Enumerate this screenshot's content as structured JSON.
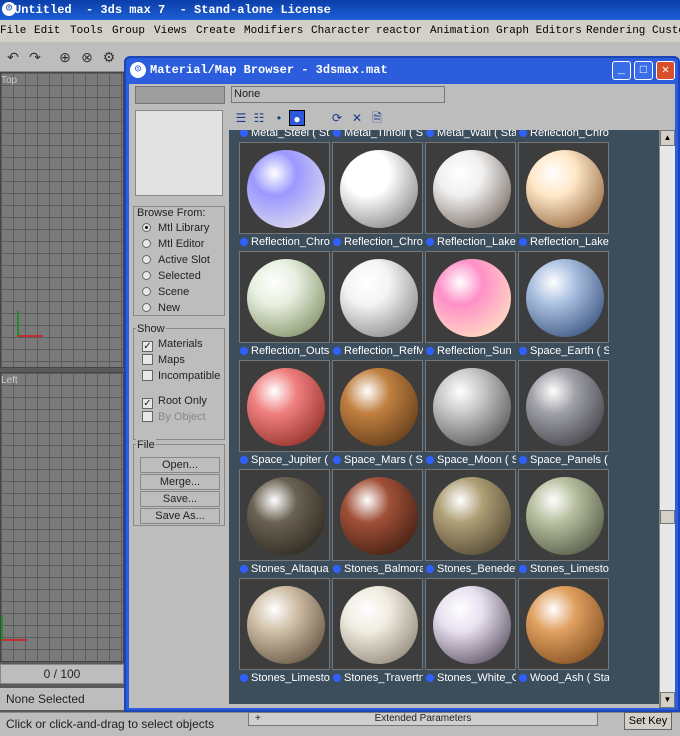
{
  "app": {
    "title": "Untitled  - 3ds max 7  - Stand-alone License",
    "menu": [
      "File",
      "Edit",
      "Tools",
      "Group",
      "Views",
      "Create",
      "Modifiers",
      "Character",
      "reactor",
      "Animation",
      "Graph Editors",
      "Rendering",
      "Custo"
    ]
  },
  "viewports": {
    "top_label": "Top",
    "left_label": "Left"
  },
  "timeslider": {
    "text": "0 / 100"
  },
  "status": {
    "selection": "None Selected",
    "prompt": "Click or click-and-drag to select objects",
    "set_key": "Set Key",
    "extended_params": "Extended Parameters"
  },
  "dialog": {
    "title": "Material/Map Browser - 3dsmax.mat",
    "filter_value": "None",
    "browse_from": {
      "label": "Browse From:",
      "options": [
        "Mtl Library",
        "Mtl Editor",
        "Active Slot",
        "Selected",
        "Scene",
        "New"
      ],
      "selected": "Mtl Library"
    },
    "show": {
      "label": "Show",
      "materials": "Materials",
      "maps": "Maps",
      "incompatible": "Incompatible",
      "root_only": "Root Only",
      "by_object": "By Object"
    },
    "file": {
      "label": "File",
      "buttons": [
        "Open...",
        "Merge...",
        "Save...",
        "Save As..."
      ]
    },
    "materials": [
      {
        "label": "Metal_Steel  ( St",
        "c1": "#d0d0d0",
        "c2": "#555"
      },
      {
        "label": "Metal_Tinfoil  ( S",
        "c1": "#e0e0e0",
        "c2": "#666"
      },
      {
        "label": "Metal_Wall  ( Sta",
        "c1": "#bbb",
        "c2": "#444"
      },
      {
        "label": "Reflection_Chror",
        "c1": "#ccc",
        "c2": "#555"
      },
      {
        "label": "Reflection_Chror",
        "c1": "#9a98ff",
        "c2": "#f0efe8"
      },
      {
        "label": "Reflection_Chror",
        "c1": "#ffffff",
        "c2": "#6a6a6a"
      },
      {
        "label": "Reflection_Lake",
        "c1": "#f0f0f0",
        "c2": "#5a4a40"
      },
      {
        "label": "Reflection_Lake",
        "c1": "#ffe8c8",
        "c2": "#7a4a20"
      },
      {
        "label": "Reflection_Outsi",
        "c1": "#e8f0e0",
        "c2": "#6a7a4a"
      },
      {
        "label": "Reflection_RefM",
        "c1": "#f4f4f4",
        "c2": "#707070"
      },
      {
        "label": "Reflection_Sun",
        "c1": "#ff90c8",
        "c2": "#fff4c0"
      },
      {
        "label": "Space_Earth  ( S",
        "c1": "#aac0e0",
        "c2": "#203a68"
      },
      {
        "label": "Space_Jupiter  (",
        "c1": "#f08080",
        "c2": "#7a1a10"
      },
      {
        "label": "Space_Mars  ( Sp",
        "c1": "#c08040",
        "c2": "#4a2a10"
      },
      {
        "label": "Space_Moon  ( S",
        "c1": "#c8c8c8",
        "c2": "#3a3a3a"
      },
      {
        "label": "Space_Panels  (",
        "c1": "#a0a0a8",
        "c2": "#2a2a30"
      },
      {
        "label": "Stones_Altaqua",
        "c1": "#6a6252",
        "c2": "#1e1a14"
      },
      {
        "label": "Stones_Balmora",
        "c1": "#a05038",
        "c2": "#2a1208"
      },
      {
        "label": "Stones_Benedet",
        "c1": "#b0a078",
        "c2": "#3a3020"
      },
      {
        "label": "Stones_Limestor",
        "c1": "#b8c0a0",
        "c2": "#3a4030"
      },
      {
        "label": "Stones_Limestor",
        "c1": "#d0c0a8",
        "c2": "#4a3a28"
      },
      {
        "label": "Stones_Travertn",
        "c1": "#f0ece0",
        "c2": "#7a7060"
      },
      {
        "label": "Stones_White_G",
        "c1": "#e8e0f0",
        "c2": "#3a3040"
      },
      {
        "label": "Wood_Ash  ( Sta",
        "c1": "#e0a060",
        "c2": "#6a3a10"
      }
    ]
  }
}
